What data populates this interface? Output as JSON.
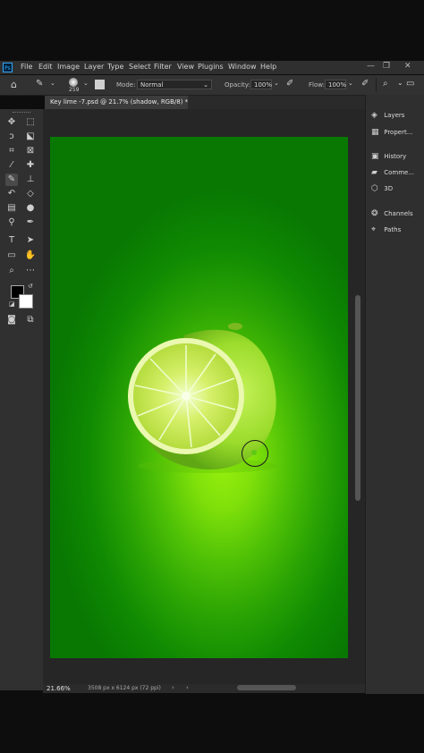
{
  "app": {
    "logo": "Ps"
  },
  "menubar": {
    "items": [
      "File",
      "Edit",
      "Image",
      "Layer",
      "Type",
      "Select",
      "Filter",
      "View",
      "Plugins",
      "Window",
      "Help"
    ]
  },
  "options": {
    "brush_size": "259",
    "mode_label": "Mode:",
    "mode_value": "Normal",
    "opacity_label": "Opacity:",
    "opacity_value": "100%",
    "flow_label": "Flow:",
    "flow_value": "100%"
  },
  "document": {
    "tab_title": "Key lime -7.psd @ 21.7% (shadow, RGB/8) *",
    "zoom": "21.66%",
    "size_info": "3508 px x 6124 px (72 ppi)"
  },
  "panels": {
    "items": [
      "Layers",
      "Propert...",
      "History",
      "Comme...",
      "3D",
      "Channels",
      "Paths"
    ]
  },
  "colors": {
    "foreground": "#000000",
    "background": "#ffffff",
    "accent": "#31a8ff"
  },
  "icons": {
    "home": "home-icon",
    "brush": "brush-icon",
    "move": "move-icon",
    "marquee": "marquee-icon",
    "lasso": "lasso-icon",
    "crop": "crop-icon",
    "eyedropper": "eyedropper-icon",
    "heal": "healing-icon",
    "stamp": "stamp-icon",
    "eraser": "eraser-icon",
    "gradient": "gradient-icon",
    "pen": "pen-icon",
    "type": "type-icon",
    "shape": "rectangle-icon",
    "hand": "hand-icon",
    "zoom": "zoom-icon"
  }
}
